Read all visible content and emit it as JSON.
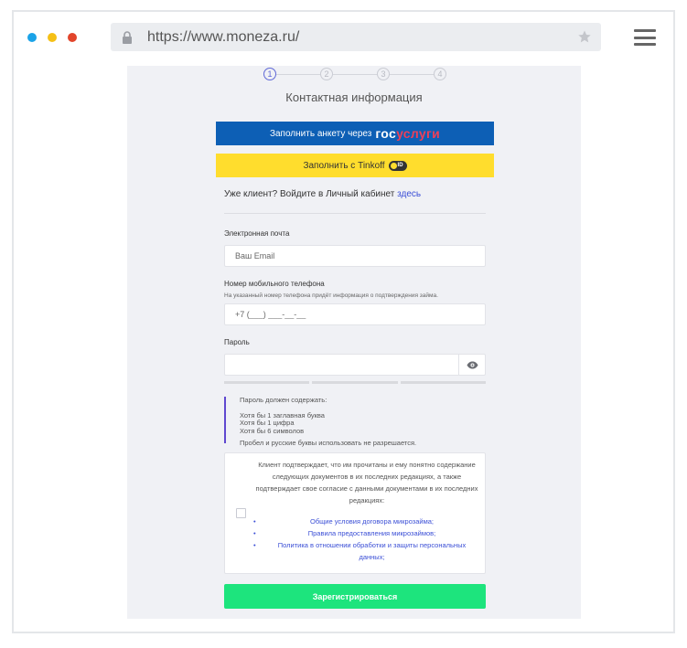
{
  "browser": {
    "url": "https://www.moneza.ru/",
    "dots": [
      "#1ba3e8",
      "#f5c016",
      "#e2452b"
    ]
  },
  "steps": [
    "1",
    "2",
    "3",
    "4"
  ],
  "page": {
    "title": "Контактная информация",
    "gos_button": {
      "prefix": "Заполнить анкету через",
      "logo_part1": "гос",
      "logo_part2": "услуги"
    },
    "tinkoff_button": {
      "label": "Заполнить с Tinkoff",
      "badge": "ID"
    },
    "login": {
      "text": "Уже клиент? Войдите в Личный кабинет",
      "link": "здесь"
    },
    "email": {
      "label": "Электронная почта",
      "placeholder": "Ваш Email"
    },
    "phone": {
      "label": "Номер мобильного телефона",
      "hint": "На указанный номер телефона придёт информация о подтверждения займа.",
      "placeholder": "+7 (___) ___-__-__"
    },
    "password": {
      "label": "Пароль"
    },
    "rules": {
      "heading": "Пароль должен содержать:",
      "items": [
        "Хотя бы 1 заглавная буква",
        "Хотя бы 1 цифра",
        "Хотя бы 6 символов"
      ],
      "footer": "Пробел и русские буквы использовать не разрешается."
    },
    "consent": {
      "text": "Клиент подтверждает, что им прочитаны и ему понятно содержание следующих документов в их последних редакциях, а также подтверждает свое согласие с данными документами в их последних редакциях:",
      "links": [
        "Общие условия договора микрозайма;",
        "Правила предоставления микрозаймов;",
        "Политика в отношении обработки и защиты персональных данных;"
      ]
    },
    "submit_label": "Зарегистрироваться"
  },
  "colors": {
    "accent": "#5f68d6",
    "gos": "#0d5fb5",
    "tinkoff": "#ffdd2d",
    "submit": "#1de47d",
    "link": "#3b4fd6"
  }
}
